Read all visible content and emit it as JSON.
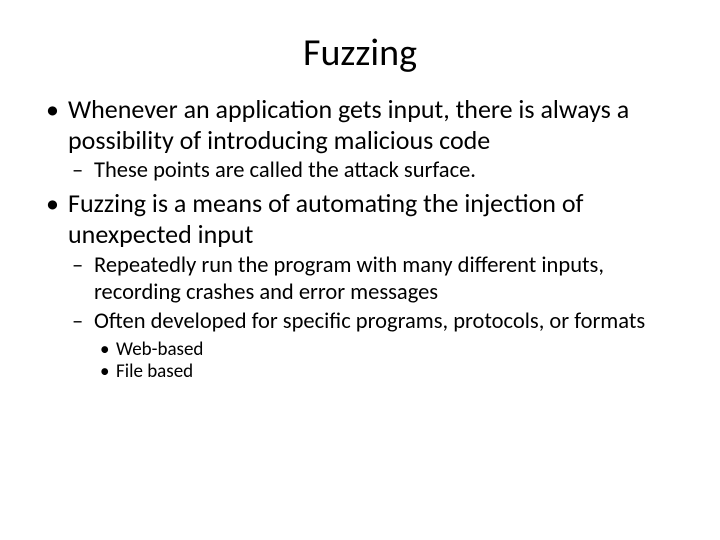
{
  "title": "Fuzzing",
  "bullets": {
    "b1": "Whenever an application gets input, there is always a possibility of introducing malicious code",
    "b1_1": "These points are called the attack surface.",
    "b2": "Fuzzing is a means of automating the injection of unexpected input",
    "b2_1": "Repeatedly run the program with many different inputs, recording crashes and error messages",
    "b2_2": "Often developed for specific programs, protocols, or formats",
    "b2_2_1": "Web-based",
    "b2_2_2": "File based"
  }
}
